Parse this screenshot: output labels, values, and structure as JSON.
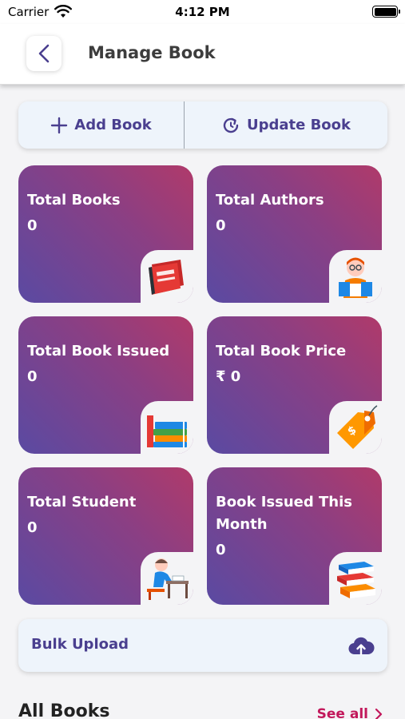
{
  "status_bar": {
    "carrier": "Carrier",
    "time": "4:12 PM"
  },
  "header": {
    "title": "Manage Book",
    "back_icon": "chevron-left-icon"
  },
  "actions": {
    "add_label": "Add Book",
    "update_label": "Update Book",
    "add_icon": "plus-icon",
    "update_icon": "refresh-icon",
    "accent_color": "#4a3f8f"
  },
  "stats": [
    {
      "title": "Total Books",
      "value": "0",
      "icon": "book-icon"
    },
    {
      "title": "Total Authors",
      "value": "0",
      "icon": "author-icon"
    },
    {
      "title": "Total Book Issued",
      "value": "0",
      "icon": "book-stack-icon"
    },
    {
      "title": "Total Book Price",
      "value": "₹ 0",
      "icon": "price-tag-icon"
    },
    {
      "title": "Total Student",
      "value": "0",
      "icon": "student-icon"
    },
    {
      "title": "Book Issued This Month",
      "value": "0",
      "icon": "books-pile-icon"
    }
  ],
  "bulk_upload": {
    "label": "Bulk Upload",
    "icon": "cloud-upload-icon"
  },
  "all_books": {
    "title": "All Books",
    "see_all": "See all"
  },
  "colors": {
    "card_gradient_start": "#5a4aa2",
    "card_gradient_end": "#b03a6a",
    "see_all": "#c2185b"
  }
}
